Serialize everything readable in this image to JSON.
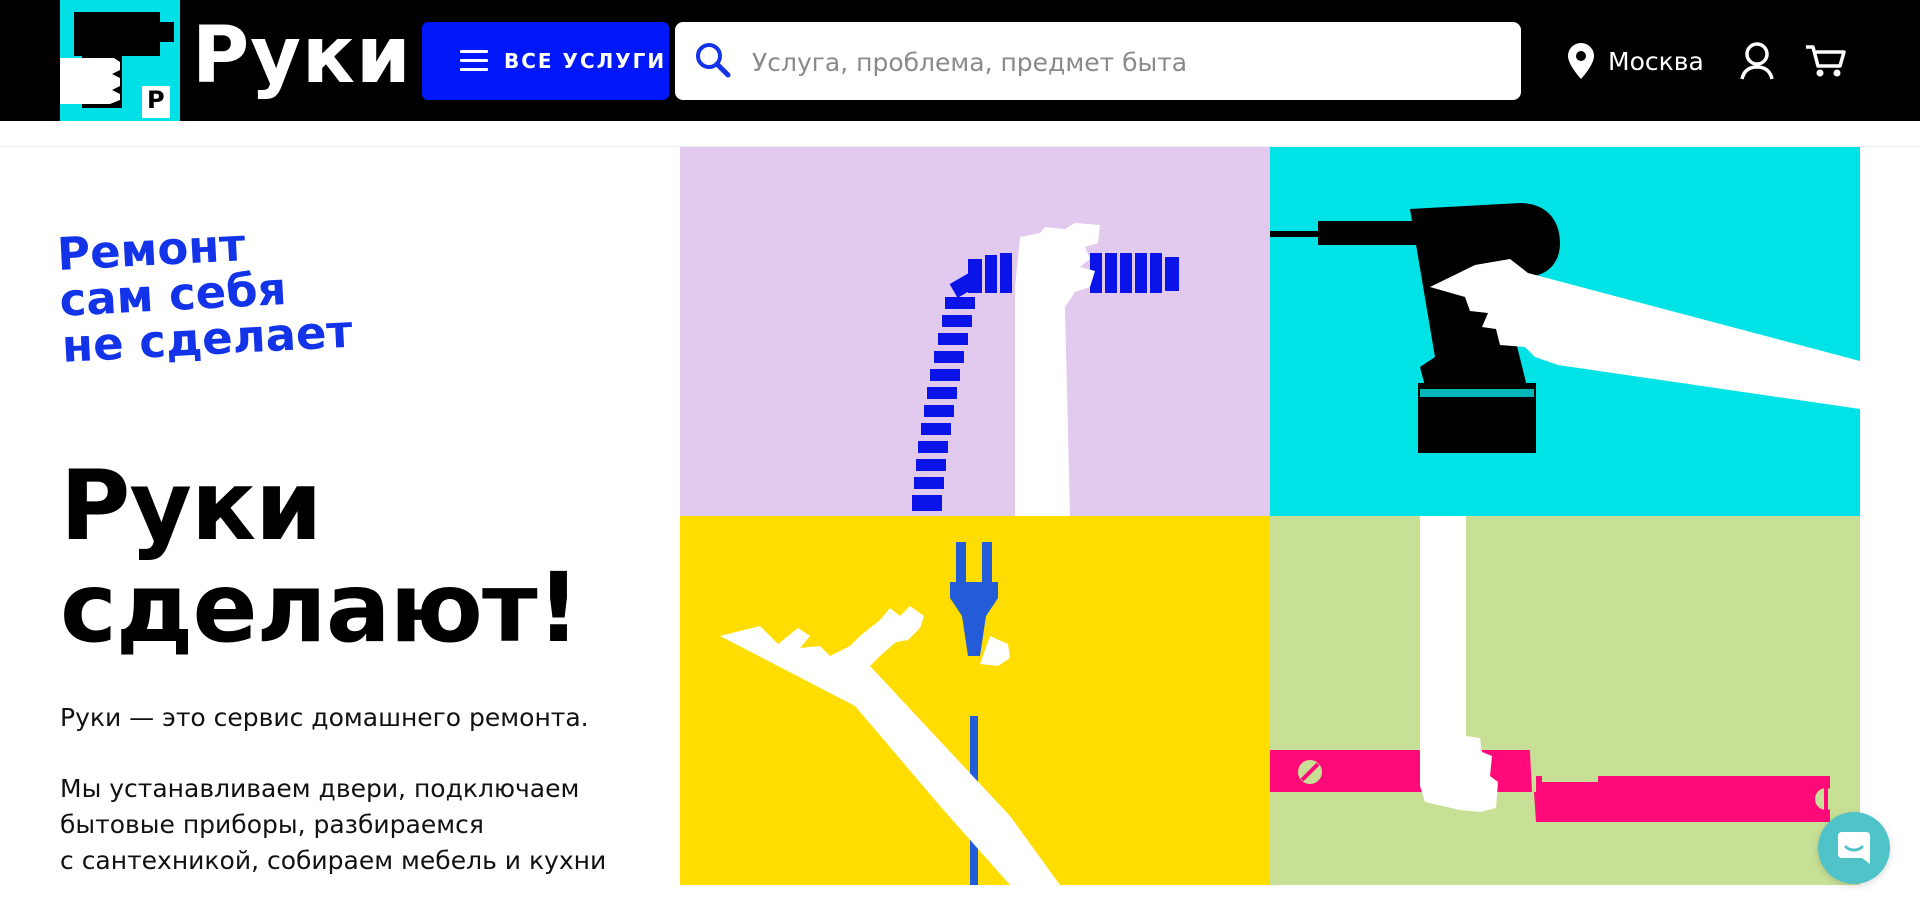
{
  "header": {
    "logo_text": "Руки",
    "logo_badge": "Р",
    "services_label": "ВСЕ УСЛУГИ",
    "search_placeholder": "Услуга, проблема, предмет быта",
    "search_value": "",
    "city": "Москва",
    "icons": [
      "search-icon",
      "location-pin-icon",
      "account-icon",
      "cart-icon",
      "menu-icon"
    ]
  },
  "hero": {
    "slogan_lines": [
      "Ремонт",
      "сам себя",
      "не сделает"
    ],
    "headline_lines": [
      "Руки",
      "сделают!"
    ],
    "description_1": "Руки — это сервис домашнего ремонта.",
    "description_2_lines": [
      "Мы устанавливаем двери, подключаем",
      "бытовые приборы, разбираемся",
      "с сантехникой, собираем мебель и кухни"
    ]
  },
  "colors": {
    "header_bg": "#000000",
    "accent_blue": "#0018f9",
    "cyan": "#00e3e6",
    "lilac": "#e2c9ee",
    "yellow": "#ffdd00",
    "lime": "#c8e096",
    "pink": "#ff0a78",
    "chat": "#4fc3c8"
  },
  "illustrations": [
    "hand-holding-hose",
    "hand-holding-drill",
    "hand-holding-plug",
    "hand-holding-level"
  ],
  "chat": {
    "icon": "chat-icon"
  }
}
